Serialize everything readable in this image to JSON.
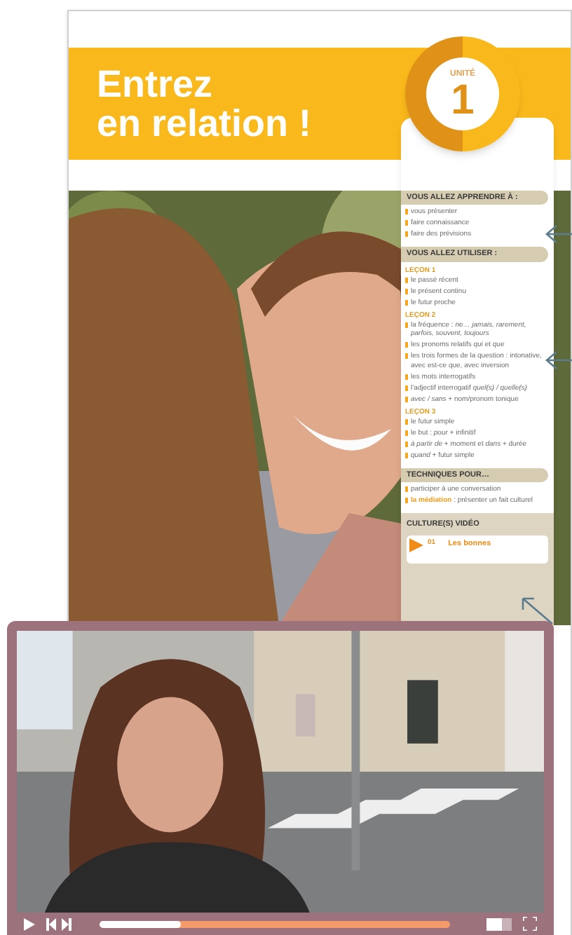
{
  "banner": {
    "title_lines": [
      "Entrez",
      "en relation !"
    ],
    "unit_label": "UNITÉ",
    "unit_number": "1"
  },
  "sidebar": {
    "sections": [
      {
        "title": "VOUS ALLEZ APPRENDRE À :",
        "groups": [
          {
            "items": [
              {
                "text": "vous présenter"
              },
              {
                "text": "faire connaissance"
              },
              {
                "text": "faire des prévisions"
              }
            ]
          }
        ]
      },
      {
        "title": "VOUS ALLEZ UTILISER :",
        "groups": [
          {
            "heading": "LEÇON 1",
            "items": [
              {
                "text": "le passé récent"
              },
              {
                "text": "le présent continu"
              },
              {
                "text": "le futur proche"
              }
            ]
          },
          {
            "heading": "LEÇON 2",
            "items": [
              {
                "text": "la fréquence : *ne… jamais, rarement, parfois, souvent, toujours*"
              },
              {
                "text": "les pronoms relatifs *qui* et *que*"
              },
              {
                "text": "les trois formes de la question : intonative, avec est-ce que, avec inversion"
              },
              {
                "text": "les mots interrogatifs"
              },
              {
                "text": "l'adjectif interrogatif *quel(s) / quelle(s)*"
              },
              {
                "text": "*avec / sans* + nom/pronom tonique"
              }
            ]
          },
          {
            "heading": "LEÇON 3",
            "items": [
              {
                "text": "le futur simple"
              },
              {
                "text": "le but : *pour* + infinitif"
              },
              {
                "text": "*à partir de* + moment et *dans* + durée"
              },
              {
                "text": "*quand* + futur simple"
              }
            ]
          }
        ]
      },
      {
        "title": "TECHNIQUES POUR…",
        "groups": [
          {
            "items": [
              {
                "text": "participer à une conversation"
              },
              {
                "label": "la médiation",
                "text": " : présenter un fait culturel"
              }
            ]
          }
        ]
      }
    ],
    "video_section": {
      "title": "CULTURE(S) VIDÉO",
      "number": "01",
      "video_title": "Les bonnes"
    }
  },
  "player": {
    "progress": {
      "level": 0.23
    },
    "volume": {
      "level": 0.6
    }
  }
}
